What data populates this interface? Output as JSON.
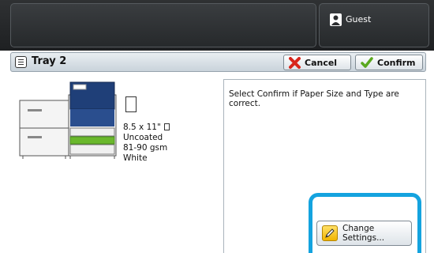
{
  "header": {
    "user_label": "Guest"
  },
  "titlebar": {
    "title": "Tray 2",
    "cancel_label": "Cancel",
    "confirm_label": "Confirm"
  },
  "paper": {
    "size": "8.5 x 11\"",
    "type": "Uncoated",
    "weight": "81-90 gsm",
    "color": "White"
  },
  "message": {
    "text": "Select Confirm if Paper Size and Type are correct."
  },
  "change_settings": {
    "line1": "Change",
    "line2": "Settings..."
  },
  "colors": {
    "accent_highlight": "#14a3df",
    "printer_blue": "#1f3f78",
    "tray_green": "#6ab82c"
  }
}
